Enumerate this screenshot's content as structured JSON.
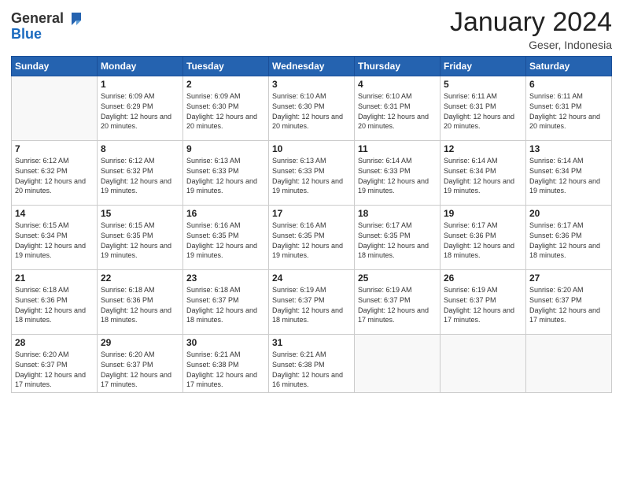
{
  "header": {
    "logo_general": "General",
    "logo_blue": "Blue",
    "month_year": "January 2024",
    "location": "Geser, Indonesia"
  },
  "days_of_week": [
    "Sunday",
    "Monday",
    "Tuesday",
    "Wednesday",
    "Thursday",
    "Friday",
    "Saturday"
  ],
  "weeks": [
    [
      {
        "num": "",
        "info": ""
      },
      {
        "num": "1",
        "info": "Sunrise: 6:09 AM\nSunset: 6:29 PM\nDaylight: 12 hours and 20 minutes."
      },
      {
        "num": "2",
        "info": "Sunrise: 6:09 AM\nSunset: 6:30 PM\nDaylight: 12 hours and 20 minutes."
      },
      {
        "num": "3",
        "info": "Sunrise: 6:10 AM\nSunset: 6:30 PM\nDaylight: 12 hours and 20 minutes."
      },
      {
        "num": "4",
        "info": "Sunrise: 6:10 AM\nSunset: 6:31 PM\nDaylight: 12 hours and 20 minutes."
      },
      {
        "num": "5",
        "info": "Sunrise: 6:11 AM\nSunset: 6:31 PM\nDaylight: 12 hours and 20 minutes."
      },
      {
        "num": "6",
        "info": "Sunrise: 6:11 AM\nSunset: 6:31 PM\nDaylight: 12 hours and 20 minutes."
      }
    ],
    [
      {
        "num": "7",
        "info": "Sunrise: 6:12 AM\nSunset: 6:32 PM\nDaylight: 12 hours and 20 minutes."
      },
      {
        "num": "8",
        "info": "Sunrise: 6:12 AM\nSunset: 6:32 PM\nDaylight: 12 hours and 19 minutes."
      },
      {
        "num": "9",
        "info": "Sunrise: 6:13 AM\nSunset: 6:33 PM\nDaylight: 12 hours and 19 minutes."
      },
      {
        "num": "10",
        "info": "Sunrise: 6:13 AM\nSunset: 6:33 PM\nDaylight: 12 hours and 19 minutes."
      },
      {
        "num": "11",
        "info": "Sunrise: 6:14 AM\nSunset: 6:33 PM\nDaylight: 12 hours and 19 minutes."
      },
      {
        "num": "12",
        "info": "Sunrise: 6:14 AM\nSunset: 6:34 PM\nDaylight: 12 hours and 19 minutes."
      },
      {
        "num": "13",
        "info": "Sunrise: 6:14 AM\nSunset: 6:34 PM\nDaylight: 12 hours and 19 minutes."
      }
    ],
    [
      {
        "num": "14",
        "info": "Sunrise: 6:15 AM\nSunset: 6:34 PM\nDaylight: 12 hours and 19 minutes."
      },
      {
        "num": "15",
        "info": "Sunrise: 6:15 AM\nSunset: 6:35 PM\nDaylight: 12 hours and 19 minutes."
      },
      {
        "num": "16",
        "info": "Sunrise: 6:16 AM\nSunset: 6:35 PM\nDaylight: 12 hours and 19 minutes."
      },
      {
        "num": "17",
        "info": "Sunrise: 6:16 AM\nSunset: 6:35 PM\nDaylight: 12 hours and 19 minutes."
      },
      {
        "num": "18",
        "info": "Sunrise: 6:17 AM\nSunset: 6:35 PM\nDaylight: 12 hours and 18 minutes."
      },
      {
        "num": "19",
        "info": "Sunrise: 6:17 AM\nSunset: 6:36 PM\nDaylight: 12 hours and 18 minutes."
      },
      {
        "num": "20",
        "info": "Sunrise: 6:17 AM\nSunset: 6:36 PM\nDaylight: 12 hours and 18 minutes."
      }
    ],
    [
      {
        "num": "21",
        "info": "Sunrise: 6:18 AM\nSunset: 6:36 PM\nDaylight: 12 hours and 18 minutes."
      },
      {
        "num": "22",
        "info": "Sunrise: 6:18 AM\nSunset: 6:36 PM\nDaylight: 12 hours and 18 minutes."
      },
      {
        "num": "23",
        "info": "Sunrise: 6:18 AM\nSunset: 6:37 PM\nDaylight: 12 hours and 18 minutes."
      },
      {
        "num": "24",
        "info": "Sunrise: 6:19 AM\nSunset: 6:37 PM\nDaylight: 12 hours and 18 minutes."
      },
      {
        "num": "25",
        "info": "Sunrise: 6:19 AM\nSunset: 6:37 PM\nDaylight: 12 hours and 17 minutes."
      },
      {
        "num": "26",
        "info": "Sunrise: 6:19 AM\nSunset: 6:37 PM\nDaylight: 12 hours and 17 minutes."
      },
      {
        "num": "27",
        "info": "Sunrise: 6:20 AM\nSunset: 6:37 PM\nDaylight: 12 hours and 17 minutes."
      }
    ],
    [
      {
        "num": "28",
        "info": "Sunrise: 6:20 AM\nSunset: 6:37 PM\nDaylight: 12 hours and 17 minutes."
      },
      {
        "num": "29",
        "info": "Sunrise: 6:20 AM\nSunset: 6:37 PM\nDaylight: 12 hours and 17 minutes."
      },
      {
        "num": "30",
        "info": "Sunrise: 6:21 AM\nSunset: 6:38 PM\nDaylight: 12 hours and 17 minutes."
      },
      {
        "num": "31",
        "info": "Sunrise: 6:21 AM\nSunset: 6:38 PM\nDaylight: 12 hours and 16 minutes."
      },
      {
        "num": "",
        "info": ""
      },
      {
        "num": "",
        "info": ""
      },
      {
        "num": "",
        "info": ""
      }
    ]
  ]
}
